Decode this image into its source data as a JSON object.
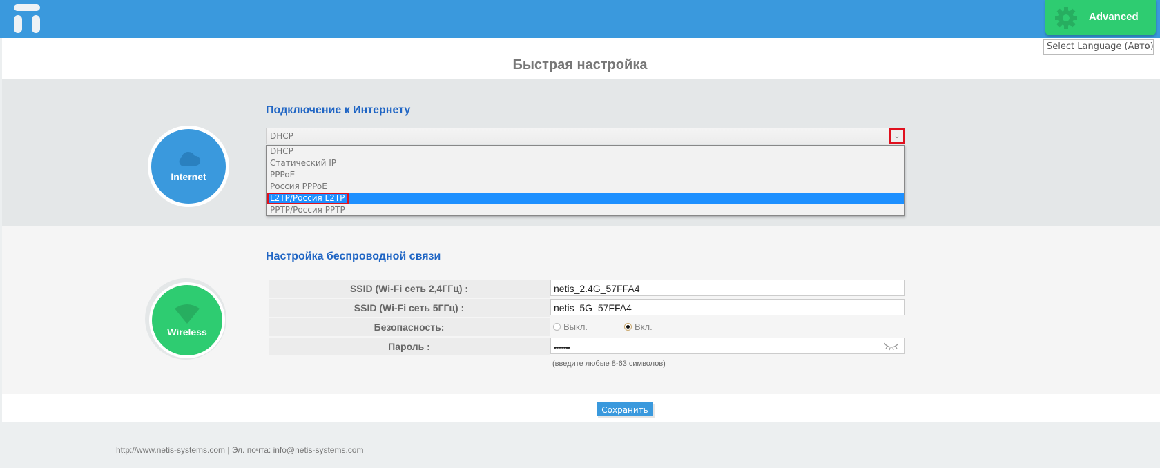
{
  "header": {
    "logo_icon": "netis-logo-icon",
    "advanced_button": {
      "label": "Advanced",
      "icon": "gear-icon"
    },
    "brand_color": "#3a99dd",
    "advanced_color": "#2ecc71"
  },
  "language_select": {
    "value": "Select Language (Авто)"
  },
  "page_title": "Быстрая настройка",
  "internet": {
    "circle_label": "Internet",
    "icon": "cloud-icon",
    "section_title": "Подключение к Интернету",
    "connection_select": {
      "value": "DHCP",
      "options": [
        "DHCP",
        "Статический IP",
        "PPPoE",
        "Россия PPPoE",
        "L2TP/Россия L2TP",
        "PPTP/Россия PPTP"
      ],
      "highlighted": "L2TP/Россия L2TP"
    }
  },
  "wireless": {
    "circle_label": "Wireless",
    "icon": "wifi-icon",
    "section_title": "Настройка беспроводной связи",
    "rows": [
      {
        "label": "SSID (Wi-Fi сеть 2,4ГГц) :",
        "value": "netis_2.4G_57FFA4"
      },
      {
        "label": "SSID (Wi-Fi сеть 5ГГц) :",
        "value": "netis_5G_57FFA4"
      },
      {
        "label": "Безопасность:",
        "options": [
          "Выкл.",
          "Вкл."
        ],
        "selected": "Вкл."
      },
      {
        "label": "Пароль :",
        "value": "••••••••"
      }
    ],
    "password_hint": "(введите любые 8-63 символов)"
  },
  "save_button": "Сохранить",
  "footer": {
    "text": "http://www.netis-systems.com | Эл. почта: info@netis-systems.com"
  }
}
